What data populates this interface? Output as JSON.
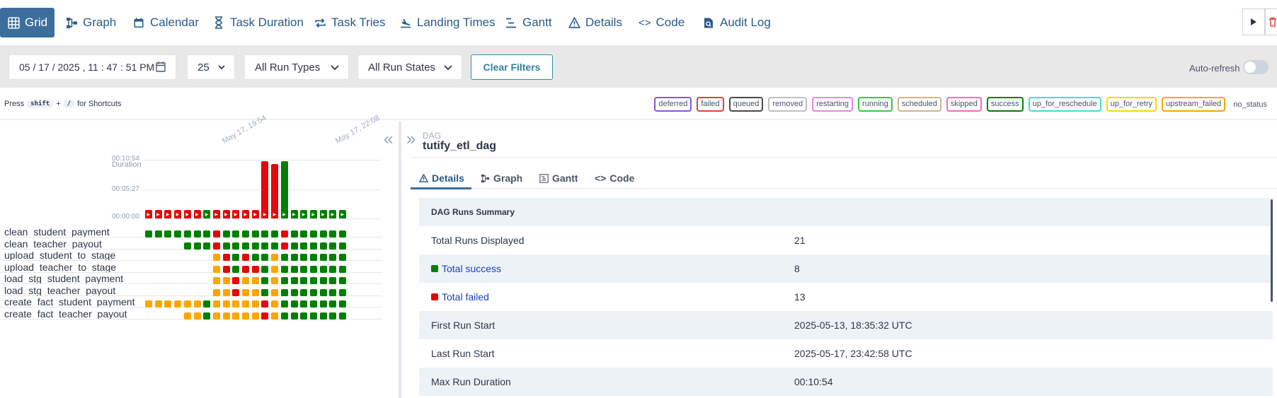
{
  "nav": {
    "tabs": [
      {
        "label": "Grid",
        "icon": "grid-icon"
      },
      {
        "label": "Graph",
        "icon": "graph-icon"
      },
      {
        "label": "Calendar",
        "icon": "calendar-icon"
      },
      {
        "label": "Task Duration",
        "icon": "hourglass-icon"
      },
      {
        "label": "Task Tries",
        "icon": "repeat-icon"
      },
      {
        "label": "Landing Times",
        "icon": "landing-icon"
      },
      {
        "label": "Gantt",
        "icon": "gantt-icon"
      },
      {
        "label": "Details",
        "icon": "warning-icon"
      },
      {
        "label": "Code",
        "icon": "code-icon"
      },
      {
        "label": "Audit Log",
        "icon": "audit-icon"
      }
    ],
    "active": "Grid"
  },
  "filters": {
    "datetime": "05 / 17 / 2025 ,  11 : 47 : 51   PM",
    "num_runs": "25",
    "run_types": "All Run Types",
    "run_states": "All Run States",
    "clear_label": "Clear Filters",
    "auto_refresh_label": "Auto-refresh"
  },
  "shortcuts": {
    "press": "Press",
    "key1": "shift",
    "plus": "+",
    "key2": "/",
    "suffix": "for Shortcuts"
  },
  "legend": [
    {
      "label": "deferred",
      "color": "#805ad5"
    },
    {
      "label": "failed",
      "color": "#e53e3e"
    },
    {
      "label": "queued",
      "color": "#4a4a4a"
    },
    {
      "label": "removed",
      "color": "#c0c0c0"
    },
    {
      "label": "restarting",
      "color": "#ee82ee"
    },
    {
      "label": "running",
      "color": "#32cd32"
    },
    {
      "label": "scheduled",
      "color": "#d2b48c"
    },
    {
      "label": "skipped",
      "color": "#ff69b4"
    },
    {
      "label": "success",
      "color": "#008000"
    },
    {
      "label": "up_for_reschedule",
      "color": "#40e0d0"
    },
    {
      "label": "up_for_retry",
      "color": "#ffd700"
    },
    {
      "label": "upstream_failed",
      "color": "#ffa500"
    },
    {
      "label": "no_status",
      "color": null
    }
  ],
  "grid": {
    "duration_label": "Duration",
    "axis_ticks": [
      "00:10:54",
      "00:05:27",
      "00:00:00"
    ],
    "date_labels": [
      "May 17, 19:54",
      "May 17, 22:08"
    ],
    "colors": {
      "success": "#008000",
      "failed": "#e4080a",
      "upstream_failed": "#ffa500"
    },
    "runs": [
      {
        "state": "failed",
        "duration_frac": 0.0
      },
      {
        "state": "failed",
        "duration_frac": 0.0
      },
      {
        "state": "failed",
        "duration_frac": 0.0
      },
      {
        "state": "failed",
        "duration_frac": 0.0
      },
      {
        "state": "failed",
        "duration_frac": 0.0
      },
      {
        "state": "failed",
        "duration_frac": 0.0
      },
      {
        "state": "success",
        "duration_frac": 0.0
      },
      {
        "state": "failed",
        "duration_frac": 0.0
      },
      {
        "state": "failed",
        "duration_frac": 0.0
      },
      {
        "state": "failed",
        "duration_frac": 0.0
      },
      {
        "state": "failed",
        "duration_frac": 0.0
      },
      {
        "state": "failed",
        "duration_frac": 0.0
      },
      {
        "state": "failed",
        "duration_frac": 1.0
      },
      {
        "state": "failed",
        "duration_frac": 0.95
      },
      {
        "state": "success",
        "duration_frac": 1.0
      },
      {
        "state": "success",
        "duration_frac": 0.0
      },
      {
        "state": "success",
        "duration_frac": 0.0
      },
      {
        "state": "success",
        "duration_frac": 0.0
      },
      {
        "state": "success",
        "duration_frac": 0.0
      },
      {
        "state": "success",
        "duration_frac": 0.0
      },
      {
        "state": "success",
        "duration_frac": 0.0
      }
    ],
    "tasks": [
      {
        "name": "clean_student_payment",
        "cells": "SSSSSSSFSSSSSSFSSSSSS"
      },
      {
        "name": "clean_teacher_payout",
        "cells": "----SSSFSSSSSSFSSSSSS"
      },
      {
        "name": "upload_student_to_stage",
        "cells": "-------UFSFSSUSSSSSSS"
      },
      {
        "name": "upload_teacher_to_stage",
        "cells": "-------UFSFFSUSSSSSSS"
      },
      {
        "name": "load_stg_student_payment",
        "cells": "-------UUFUUSUSSSSSSS"
      },
      {
        "name": "load_stg_teacher_payout",
        "cells": "-------UUFUUSUSSSSSSS"
      },
      {
        "name": "create_fact_student_payment",
        "cells": "UUUUUUSUUUUUFUSSSSSSS"
      },
      {
        "name": "create_fact_teacher_payout",
        "cells": "----UUSUUUUUFUSSSSSSS"
      }
    ]
  },
  "dag": {
    "small_label": "DAG",
    "name": "tutify_etl_dag"
  },
  "details_tabs": [
    {
      "label": "Details",
      "icon": "warning-icon"
    },
    {
      "label": "Graph",
      "icon": "graph-icon"
    },
    {
      "label": "Gantt",
      "icon": "gantt-icon"
    },
    {
      "label": "Code",
      "icon": "code-icon"
    }
  ],
  "summary": {
    "header": "DAG Runs Summary",
    "rows": [
      {
        "label": "Total Runs Displayed",
        "value": "21"
      },
      {
        "label": "Total success",
        "value": "8",
        "status_color": "#008000",
        "link": true
      },
      {
        "label": "Total failed",
        "value": "13",
        "status_color": "#e4080a",
        "link": true
      },
      {
        "label": "First Run Start",
        "value": "2025-05-13, 18:35:32 UTC"
      },
      {
        "label": "Last Run Start",
        "value": "2025-05-17, 23:42:58 UTC"
      },
      {
        "label": "Max Run Duration",
        "value": "00:10:54"
      }
    ]
  }
}
